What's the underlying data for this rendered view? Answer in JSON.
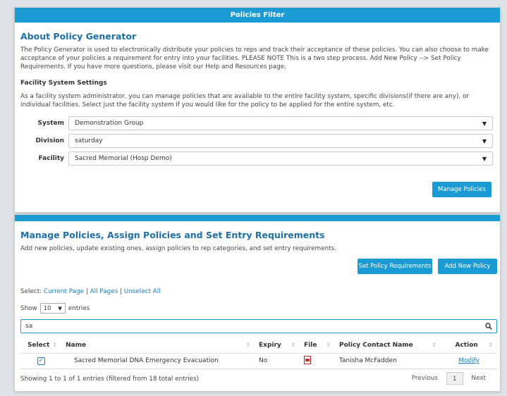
{
  "filter_panel": {
    "header": "Policies Filter",
    "about_title": "About Policy Generator",
    "about_text": "The Policy Generator is used to electronically distribute your policies to reps and track their acceptance of these policies. You can also choose to make acceptance of your policies a requirement for entry into your facilities. PLEASE NOTE This is a two step process. Add New Policy --> Set Policy Requirements. If you have more questions, please visit our Help and Resources page.",
    "settings_title": "Facility System Settings",
    "settings_text": "As a facility system administrator, you can manage policies that are available to the entire facility system, specific divisions(if there are any), or individual facilities. Select just the facility system if you would like for the policy to be applied for the entire system, etc.",
    "fields": [
      {
        "label": "System",
        "value": "Demonstration Group"
      },
      {
        "label": "Division",
        "value": "saturday"
      },
      {
        "label": "Facility",
        "value": "Sacred Memorial (Hosp Demo)"
      }
    ],
    "manage_button": "Manage Policies"
  },
  "manage_panel": {
    "title": "Manage Policies, Assign Policies and Set Entry Requirements",
    "subtitle": "Add new policies, update existing ones, assign policies to rep categories, and set entry requirements.",
    "set_requirements_button": "Set Policy Requirements",
    "add_policy_button": "Add New Policy",
    "select_label": "Select:",
    "select_current": "Current Page",
    "select_all": "All Pages",
    "unselect_all": "Unselect All",
    "separator": "|",
    "show_label": "Show",
    "page_length": "10",
    "entries_label": "entries",
    "search_value": "sa",
    "columns": [
      "Select",
      "Name",
      "Expiry",
      "File",
      "Policy Contact Name",
      "Action"
    ],
    "rows": [
      {
        "name": "Sacred Memorial DNA Emergency Evacuation",
        "expiry": "No",
        "contact": "Tanisha McFadden",
        "action": "Modify"
      }
    ],
    "info": "Showing 1 to 1 of 1 entries (filtered from 18 total entries)",
    "pager": {
      "previous": "Previous",
      "page": "1",
      "next": "Next"
    }
  },
  "colors": {
    "accent": "#1a9bd3",
    "title": "#1d6fa5",
    "link": "#1a7fc1"
  }
}
